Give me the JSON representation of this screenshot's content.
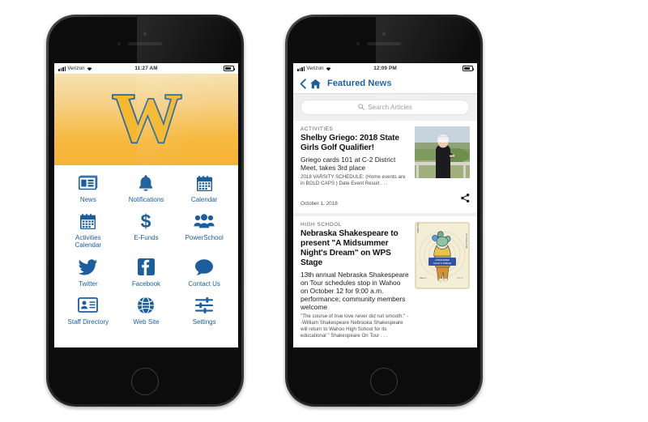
{
  "phones": {
    "left": {
      "status": {
        "carrier": "Verizon",
        "time": "11:27 AM",
        "wifi_icon": "wifi-icon",
        "battery_icon": "battery-icon",
        "signal_icon": "signal-bars-icon"
      },
      "logo": {
        "letter": "W",
        "name": "school-w-logo"
      },
      "grid": [
        {
          "label": "News",
          "icon": "news-icon"
        },
        {
          "label": "Notifications",
          "icon": "bell-icon"
        },
        {
          "label": "Calendar",
          "icon": "calendar-icon"
        },
        {
          "label": "Activities Calendar",
          "icon": "calendar-icon"
        },
        {
          "label": "E-Funds",
          "icon": "dollar-icon"
        },
        {
          "label": "PowerSchool",
          "icon": "people-group-icon"
        },
        {
          "label": "Twitter",
          "icon": "twitter-bird-icon"
        },
        {
          "label": "Facebook",
          "icon": "facebook-icon"
        },
        {
          "label": "Contact Us",
          "icon": "speech-bubble-icon"
        },
        {
          "label": "Staff Directory",
          "icon": "id-card-icon"
        },
        {
          "label": "Web Site",
          "icon": "globe-icon"
        },
        {
          "label": "Settings",
          "icon": "sliders-icon"
        }
      ]
    },
    "right": {
      "status": {
        "carrier": "Verizon",
        "time": "12:09 PM",
        "wifi_icon": "wifi-icon",
        "battery_icon": "battery-icon",
        "signal_icon": "signal-bars-icon"
      },
      "navbar": {
        "back_icon": "chevron-left-icon",
        "home_icon": "home-icon",
        "title": "Featured News"
      },
      "search": {
        "placeholder": "Search Articles",
        "icon": "search-icon"
      },
      "articles": [
        {
          "kicker": "ACTIVITIES",
          "headline": "Shelby Griego: 2018 State Girls Golf Qualifier!",
          "subhead": "Griego cards 101 at C-2 District Meet, takes 3rd place",
          "excerpt": "2018 VARSITY SCHEDULE: (Home events are in BOLD CAPS )  Date  Event  Result . . .",
          "date": "October 1, 2018",
          "thumb": "golf-photo",
          "share_icon": "share-icon"
        },
        {
          "kicker": "HIGH SCHOOL",
          "headline": "Nebraska Shakespeare to present \"A Midsummer Night's Dream\" on WPS Stage",
          "subhead": "13th annual Nebraska Shakespeare on Tour schedules stop in Wahoo on October 12 for 9:00 a.m. performance; community members welcome",
          "excerpt": "\"The course of true love never did run smooth.\" --William Shakespeare Nebraska Shakespeare will return to Wahoo High School for its educational \" Shakespeare On Tour . . .",
          "date": "",
          "thumb": "shakespeare-poster",
          "share_icon": "share-icon"
        }
      ]
    }
  },
  "colors": {
    "brand_blue": "#1b5e9e",
    "gold": "#f5b72c",
    "feed_bg": "#efeff0"
  }
}
